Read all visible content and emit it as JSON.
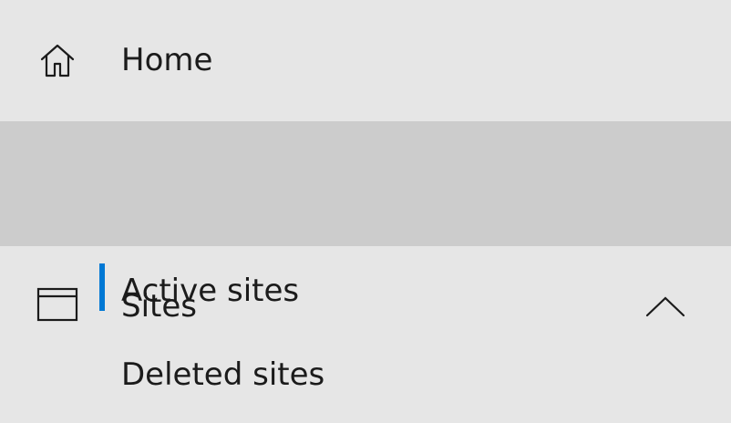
{
  "nav": {
    "home": {
      "icon": "home-icon",
      "label": "Home"
    },
    "sites": {
      "icon": "browser-window-icon",
      "label": "Sites",
      "expanded": true,
      "expand_icon": "chevron-up-icon",
      "children": [
        {
          "label": "Active sites",
          "selected": true
        },
        {
          "label": "Deleted sites",
          "selected": false
        }
      ]
    }
  },
  "colors": {
    "background": "#e6e6e6",
    "expanded_section_background": "#cccccc",
    "selected_indicator": "#0078d4",
    "text": "#1b1b1b"
  }
}
